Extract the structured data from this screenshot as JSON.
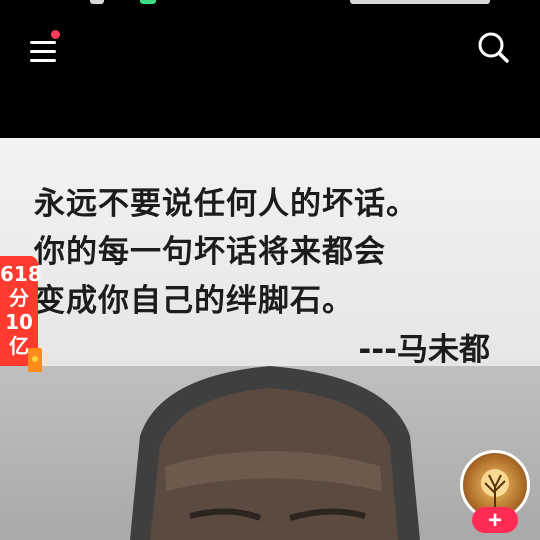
{
  "header": {
    "menu_icon": "hamburger-menu-icon",
    "search_icon": "search-icon",
    "notification_dot_color": "#ff3b5c"
  },
  "post": {
    "quote_lines": [
      "永远不要说任何人的坏话。",
      "你的每一句坏话将来都会",
      "变成你自己的绊脚石。"
    ],
    "quote_author": "---马未都"
  },
  "promo": {
    "lines": [
      "618",
      "分",
      "10",
      "亿"
    ],
    "close_glyph": "×",
    "color": "#ff3b2f"
  },
  "creator": {
    "follow_glyph": "+",
    "follow_color": "#fe2c55"
  }
}
